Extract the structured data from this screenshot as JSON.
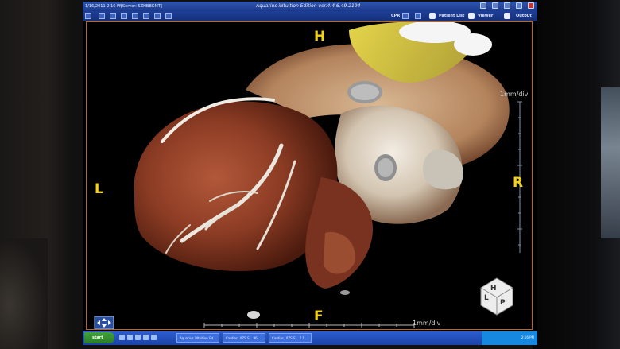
{
  "window": {
    "date_time": "1/16/2011  2:16 PM",
    "server": "[Server: SZHBBGMT]",
    "app_title": "Aquarius iNtuition Edition ver.4.4.6.49.2194",
    "mode": "CPR",
    "patient_list_label": "Patient List",
    "viewer_label": "Viewer",
    "output_label": "Output"
  },
  "viewer": {
    "orientation": {
      "top": "H",
      "bottom": "F",
      "left": "L",
      "right": "R"
    },
    "scale_right": "1mm/div",
    "scale_bottom": "1mm/div",
    "cube_letters": [
      "H",
      "L",
      "P"
    ]
  },
  "taskbar": {
    "start_label": "start",
    "tasks": [
      "Aquarius iNtuition Ed...",
      "Cardiac, XZS S... 96...",
      "Cardiac, XZS S... 7.1..."
    ],
    "clock": "2:16 PM"
  }
}
